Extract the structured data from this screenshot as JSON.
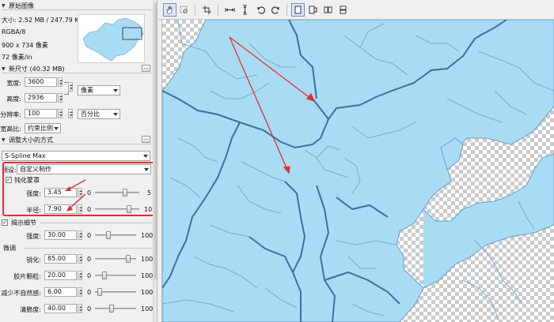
{
  "sections": {
    "original": "原始图像",
    "new_size": "新尺寸 (40.32 MB)",
    "resample": "调整大小的方式",
    "unsharp": "钝化蒙罩",
    "detail": "揭示细节",
    "fine_tune": "微调"
  },
  "original_info": {
    "size": "大小: 2.52 MB / 247.79 KB",
    "mode": "RGBA/8",
    "dims": "900 x 734 像素",
    "resolution": "72 像素/in"
  },
  "new_size": {
    "width_label": "宽度:",
    "width_value": "3600",
    "height_label": "高度:",
    "height_value": "2936",
    "res_label": "分辨率:",
    "res_value": "100",
    "unit_select": "像素",
    "res_unit_select": "百分比",
    "ratio_label": "宽高比:",
    "ratio_select": "约束比例"
  },
  "resample": {
    "method": "S-Spline Max",
    "preset_label": "预设:",
    "preset_value": "自定义制作"
  },
  "unsharp": {
    "strength_label": "强度:",
    "strength_value": "3.45",
    "strength_min": "0",
    "strength_max": "5",
    "strength_level": 0.69,
    "radius_label": "半径:",
    "radius_value": "7.90",
    "radius_min": "0",
    "radius_max": "10",
    "radius_level": 0.79
  },
  "detail": {
    "strength_label": "强度:",
    "strength_value": "30.00",
    "min": "0",
    "max": "100",
    "level": 0.3
  },
  "fine_tune": {
    "rows": [
      {
        "label": "锐化:",
        "value": "85.00",
        "min": "0",
        "max": "100",
        "level": 0.85
      },
      {
        "label": "胶片颗粒:",
        "value": "20.00",
        "min": "0",
        "max": "100",
        "level": 0.2
      },
      {
        "label": "减少不自然感:",
        "value": "6.00",
        "min": "0",
        "max": "100",
        "level": 0.06
      },
      {
        "label": "清脆度:",
        "value": "40.00",
        "min": "0",
        "max": "100",
        "level": 0.4
      }
    ]
  },
  "colors": {
    "accent_red": "#e03030",
    "map_fill": "#a8dcf4",
    "map_border": "#3e6f9e"
  },
  "toolbar": {
    "icons": [
      "hand-icon",
      "zoom-box-icon",
      "crop-icon",
      "fit-width-icon",
      "fit-height-icon",
      "rotate-left-icon",
      "rotate-right-icon",
      "single-view-icon",
      "split-vertical-icon",
      "side-by-side-icon",
      "split-horizontal-icon"
    ]
  }
}
